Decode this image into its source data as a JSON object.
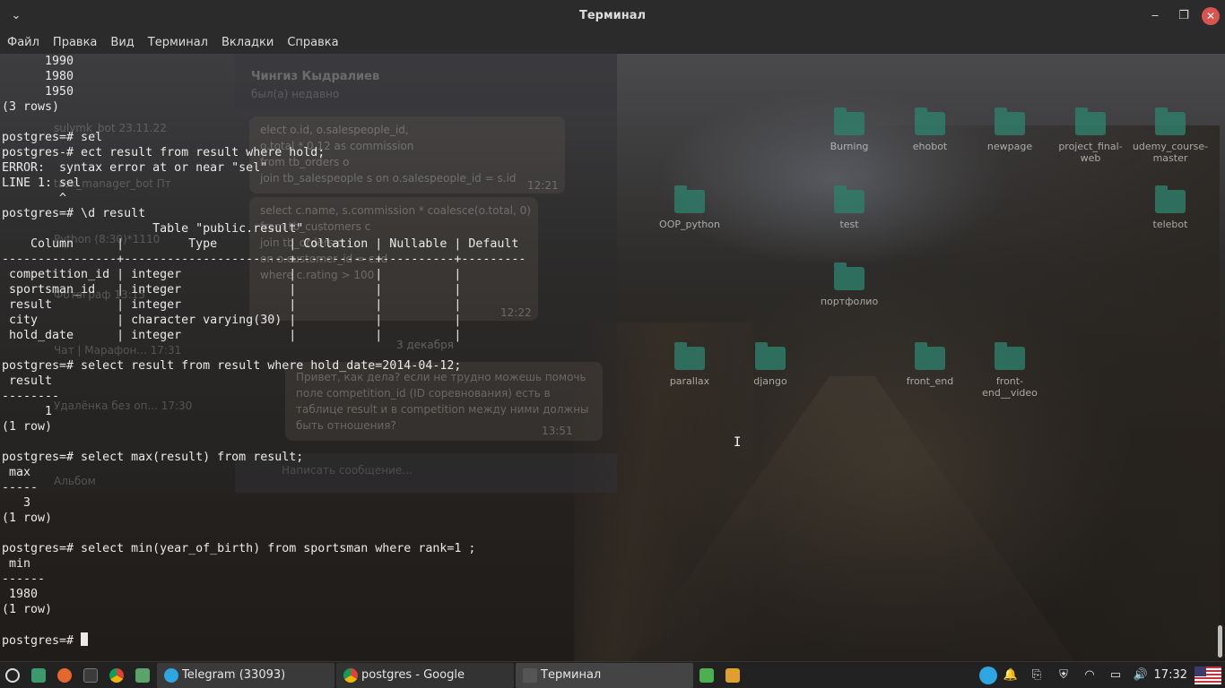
{
  "window": {
    "title": "Терминал"
  },
  "menu": [
    "Файл",
    "Правка",
    "Вид",
    "Терминал",
    "Вкладки",
    "Справка"
  ],
  "terminal": {
    "lines": [
      "      1990",
      "      1980",
      "      1950",
      "(3 rows)",
      "",
      "postgres=# sel",
      "postgres-# ect result from result where hold;",
      "ERROR:  syntax error at or near \"sel\"",
      "LINE 1: sel",
      "        ^",
      "postgres=# \\d result",
      "                     Table \"public.result\"",
      "    Column      |         Type          | Collation | Nullable | Default",
      "----------------+-----------------------+-----------+----------+---------",
      " competition_id | integer               |           |          |",
      " sportsman_id   | integer               |           |          |",
      " result         | integer               |           |          |",
      " city           | character varying(30) |           |          |",
      " hold_date      | integer               |           |          |",
      "",
      "postgres=# select result from result where hold_date=2014-04-12;",
      " result",
      "--------",
      "      1",
      "(1 row)",
      "",
      "postgres=# select max(result) from result;",
      " max",
      "-----",
      "   3",
      "(1 row)",
      "",
      "postgres=# select min(year_of_birth) from sportsman where rank=1 ;",
      " min",
      "------",
      " 1980",
      "(1 row)",
      ""
    ],
    "prompt": "postgres=# "
  },
  "desktop_icons": [
    {
      "label": "Burning",
      "pos": "a"
    },
    {
      "label": "ehobot",
      "pos": "b"
    },
    {
      "label": "newpage",
      "pos": "c"
    },
    {
      "label": "project_final-web",
      "pos": "d"
    },
    {
      "label": "udemy_course-master",
      "pos": "e"
    },
    {
      "label": "OOP_python",
      "pos": "f"
    },
    {
      "label": "test",
      "pos": "g"
    },
    {
      "label": "telebot",
      "pos": "h"
    },
    {
      "label": "портфолио",
      "pos": "i"
    },
    {
      "label": "parallax",
      "pos": "j"
    },
    {
      "label": "django",
      "pos": "k"
    },
    {
      "label": "front_end",
      "pos": "l"
    },
    {
      "label": "front-end__video",
      "pos": "m"
    }
  ],
  "telegram_ghost": {
    "contact_name": "Чингиз Кыдралиев",
    "contact_status": "был(а) недавно",
    "chats": [
      {
        "name": "sulymk_bot",
        "time": "23.11.22"
      },
      {
        "name": "task_manager_bot",
        "time": "Пт"
      },
      {
        "name": "Python (8:30)*1110",
        "time": ""
      },
      {
        "name": "Фотограф",
        "time": "13:15"
      },
      {
        "name": "Чат | Марафон...",
        "time": "17:31"
      },
      {
        "name": "Удалёнка без оп...",
        "time": "17:30"
      },
      {
        "name": "Альбом",
        "time": ""
      }
    ],
    "message_1": "elect o.id, o.salespeople_id,\no.total * 0.12 as commission\nfrom tb_orders o\njoin tb_salespeople s on o.salespeople_id = s.id",
    "message_1_time": "12:21",
    "message_2": "select c.name, s.commission * coalesce(o.total, 0)\nfrom tb_customers c\njoin tb_orders o\non o.customer_id = c.id\nwhere c.rating > 100",
    "message_2_time": "12:22",
    "date_divider": "3 декабря",
    "message_3": "Привет, как дела? если не трудно можешь помочь\nполе competition_id (ID соревнования) есть в\nтаблице result и в competition между ними должны\nбыть отношения?",
    "message_3_time": "13:51",
    "compose_placeholder": "Написать сообщение..."
  },
  "taskbar": {
    "windows": [
      {
        "label": "Telegram (33093)",
        "icon_color": "#2ea6df"
      },
      {
        "label": "postgres - Google Chrome",
        "icon_color": "#e8a13a"
      },
      {
        "label": "Терминал",
        "icon_color": "#555555"
      }
    ],
    "clock": "17:32"
  }
}
